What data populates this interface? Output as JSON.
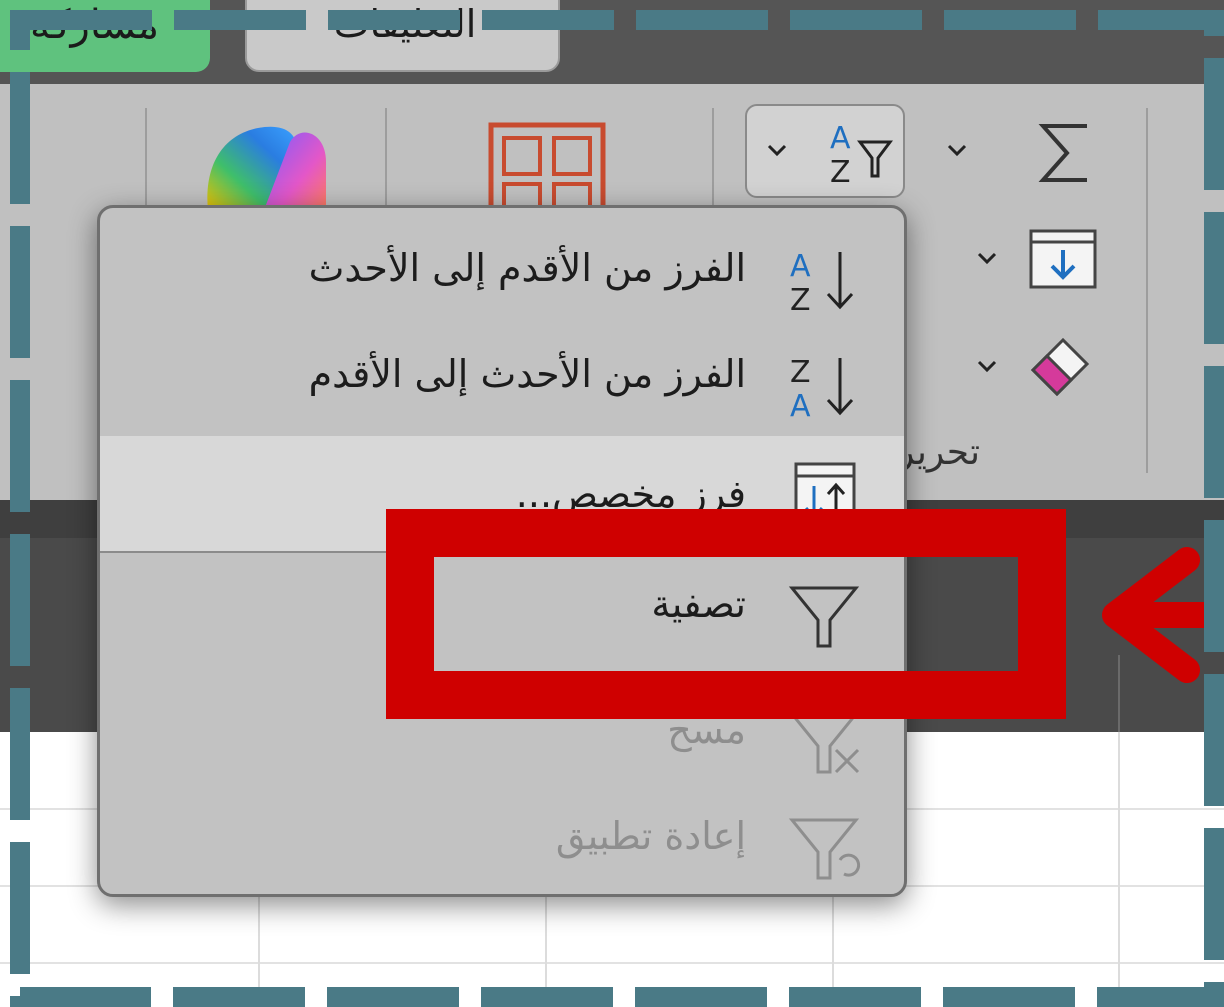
{
  "tabs": {
    "share_label": "مشاركة",
    "comments_label": "التعليقات"
  },
  "ribbon": {
    "editing_group_label": "تحرير",
    "icons": {
      "autosum": "sigma-icon",
      "fill": "fill-down-icon",
      "clear": "eraser-icon",
      "sort_filter": "sort-filter-icon",
      "analyze": "grid-layout-icon",
      "copilot": "copilot-logo"
    }
  },
  "menu": {
    "items": [
      {
        "label": "الفرز من الأقدم إلى الأحدث",
        "icon": "sort-ascending-icon",
        "enabled": true
      },
      {
        "label": "الفرز من الأحدث إلى الأقدم",
        "icon": "sort-descending-icon",
        "enabled": true
      },
      {
        "label": "فرز مخصص...",
        "icon": "custom-sort-icon",
        "enabled": true,
        "hovered": true
      },
      {
        "label": "تصفية",
        "icon": "filter-icon",
        "enabled": true,
        "highlighted": true
      },
      {
        "label": "مسح",
        "icon": "clear-filter-icon",
        "enabled": false
      },
      {
        "label": "إعادة تطبيق",
        "icon": "reapply-filter-icon",
        "enabled": false
      }
    ]
  },
  "annotation": {
    "highlight_color": "#cf0000",
    "frame_color": "#4a7a86"
  }
}
